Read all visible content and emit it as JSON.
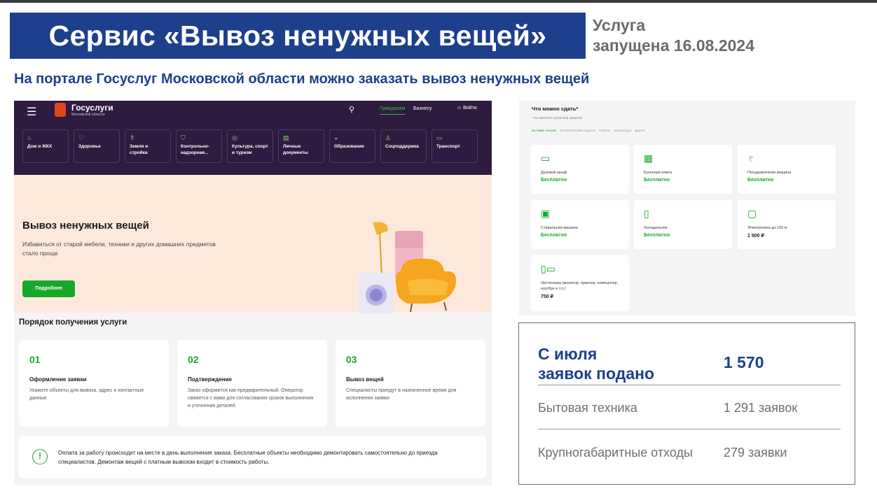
{
  "slide": {
    "title": "Сервис «Вывоз ненужных вещей»",
    "launch_line1": "Услуга",
    "launch_line2": "запущена 16.08.2024",
    "subheading": "На портале Госуслуг Московской области можно заказать вывоз ненужных вещей"
  },
  "portal": {
    "header": {
      "brand": "Госуслуги",
      "brand_sub": "Московской области",
      "nav_citizens": "Гражданам",
      "nav_business": "Бизнесу",
      "login": "Войти"
    },
    "categories": [
      {
        "icon": "home-icon",
        "label": "Дом и ЖКХ"
      },
      {
        "icon": "heart-icon",
        "label": "Здоровье"
      },
      {
        "icon": "crane-icon",
        "label": "Земля и стройка"
      },
      {
        "icon": "shield-icon",
        "label": "Контрольно-надзорная..."
      },
      {
        "icon": "globe-icon",
        "label": "Культура, спорт и туризм"
      },
      {
        "icon": "document-icon",
        "label": "Личные документы"
      },
      {
        "icon": "graduation-icon",
        "label": "Образование"
      },
      {
        "icon": "support-icon",
        "label": "Соцподдержка"
      },
      {
        "icon": "bus-icon",
        "label": "Транспорт"
      }
    ],
    "hero": {
      "title": "Вывоз ненужных вещей",
      "text": "Избавиться от старой мебели, техники и других домашних предметов стало проще",
      "button": "Подробнее"
    },
    "order_title": "Порядок получения услуги",
    "steps": [
      {
        "num": "01",
        "title": "Оформление заявки",
        "text": "Укажите объекты для вывоза, адрес и контактные данные"
      },
      {
        "num": "02",
        "title": "Подтверждение",
        "text": "Заказ оформится как предварительный. Оператор свяжется с вами для согласования сроков выполнения и уточнения деталей"
      },
      {
        "num": "03",
        "title": "Вывоз вещей",
        "text": "Специалисты приедут в назначенное время для исполнения заявки"
      }
    ],
    "note": "Оплата за работу происходит на месте в день выполнения заказа. Бесплатные объекты необходимо демонтировать самостоятельно до приезда специалистов. Демонтаж вещей с платным вывозом входит в стоимость работы."
  },
  "catalog": {
    "title": "Что можно сдать*",
    "subtitle": "* Не является публичной офертой",
    "tabs": [
      "Бытовая техника",
      "Металлические изделия",
      "Мебель",
      "Макулатура",
      "Другое"
    ],
    "items": [
      {
        "icon": "oven-icon",
        "name": "Духовой шкаф",
        "price": "Бесплатно"
      },
      {
        "icon": "stove-icon",
        "name": "Кухонная плита",
        "price": "Бесплатно"
      },
      {
        "icon": "dishwasher-icon",
        "name": "Посудомоечная машина",
        "price": "Бесплатно"
      },
      {
        "icon": "washing-machine-icon",
        "name": "Стиральная машина",
        "price": "Бесплатно"
      },
      {
        "icon": "fridge-icon",
        "name": "Холодильник",
        "price": "Бесплатно"
      },
      {
        "icon": "tv-icon",
        "name": "Электроника до 150 кг",
        "price": "1 500 ₽"
      },
      {
        "icon": "office-equipment-icon",
        "name": "Оргтехника (монитор, принтер, компьютер, ноутбук и т.п.)",
        "price": "750 ₽"
      }
    ]
  },
  "stats": {
    "label_line1": "С июля",
    "label_line2": "заявок подано",
    "total": "1 570",
    "rows": [
      {
        "label": "Бытовая техника",
        "value": "1 291 заявок"
      },
      {
        "label": "Крупногабаритные отходы",
        "value": "279 заявки"
      }
    ]
  }
}
